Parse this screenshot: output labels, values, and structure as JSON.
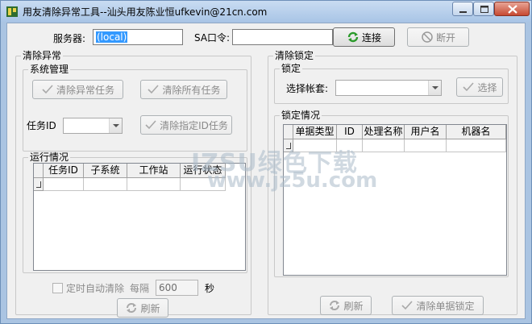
{
  "window": {
    "title": "用友清除异常工具--汕头用友陈业恒ufkevin@21cn.com"
  },
  "connection": {
    "server_label": "服务器:",
    "server_value": "(local)",
    "sa_label": "SA口令:",
    "sa_value": "",
    "connect_label": "连接",
    "disconnect_label": "断开"
  },
  "clear_exceptions": {
    "title": "清除异常",
    "system_mgmt": {
      "title": "系统管理",
      "clear_exception_tasks": "清除异常任务",
      "clear_all_tasks": "清除所有任务",
      "task_id_label": "任务ID",
      "clear_specified_task": "清除指定ID任务"
    },
    "running": {
      "title": "运行情况",
      "columns": [
        "任务ID",
        "子系统",
        "工作站",
        "运行状态"
      ]
    },
    "auto_clear_label": "定时自动清除",
    "interval_label": "每隔",
    "interval_value": "600",
    "seconds_label": "秒",
    "refresh_label": "刷新"
  },
  "clear_locks": {
    "title": "清除锁定",
    "lock": {
      "title": "锁定",
      "select_account_label": "选择帐套:",
      "select_label": "选择"
    },
    "lock_status": {
      "title": "锁定情况",
      "columns": [
        "单据类型",
        "ID",
        "处理名称",
        "用户名",
        "机器名"
      ]
    },
    "refresh_label": "刷新",
    "clear_doc_lock_label": "清除单据锁定"
  },
  "watermark": {
    "line1": "IZSU绿色下载",
    "line2": "www.jz5u.com"
  },
  "colors": {
    "selection": "#3399ff",
    "connect_icon": "#2a9a2a",
    "window_frame": "#aac4e2"
  }
}
